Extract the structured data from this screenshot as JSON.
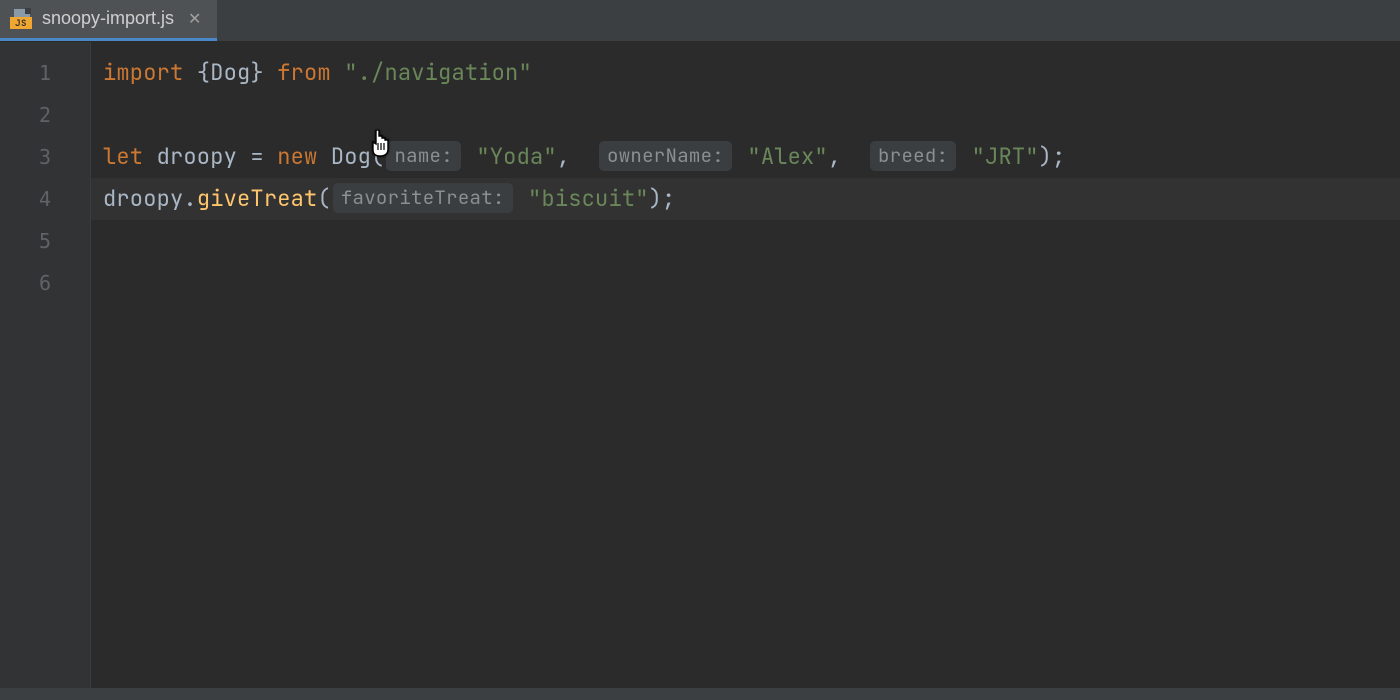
{
  "tab": {
    "filename": "snoopy-import.js",
    "badge": "JS"
  },
  "gutter": [
    "1",
    "2",
    "3",
    "4",
    "5",
    "6"
  ],
  "code": {
    "l1": {
      "kw_import": "import",
      "brace_open": "{",
      "Dog": "Dog",
      "brace_close": "}",
      "kw_from": "from",
      "str_path": "\"./navigation\""
    },
    "l3": {
      "kw_let": "let",
      "var": "droopy",
      "eq": "=",
      "kw_new": "new",
      "ctor": "Dog",
      "paren_open": "(",
      "hint_name": "name:",
      "str_name": "\"Yoda\"",
      "comma1": ",",
      "hint_owner": "ownerName:",
      "str_owner": "\"Alex\"",
      "comma2": ",",
      "hint_breed": "breed:",
      "str_breed": "\"JRT\"",
      "paren_close_semi": ");"
    },
    "l4": {
      "obj": "droopy",
      "dot": ".",
      "method": "giveTreat",
      "paren_open": "(",
      "hint_treat": "favoriteTreat:",
      "str_treat": "\"biscuit\"",
      "paren_close_semi": ");"
    }
  }
}
